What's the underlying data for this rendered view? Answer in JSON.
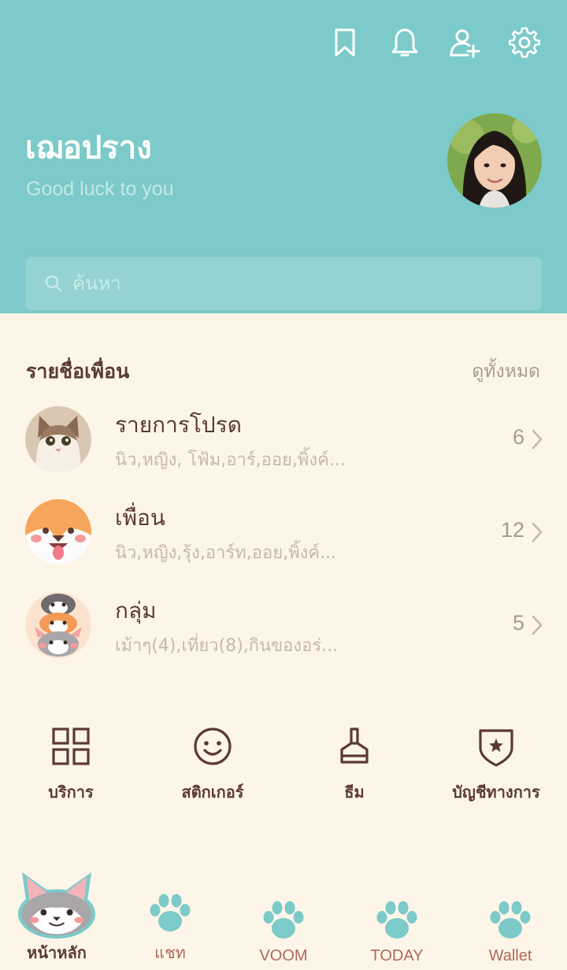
{
  "header": {
    "icons": [
      "bookmark-icon",
      "bell-icon",
      "add-friend-icon",
      "gear-icon"
    ],
    "profile_name": "เฌอปราง",
    "status_message": "Good luck to you",
    "search_placeholder": "ค้นหา"
  },
  "friends_section": {
    "title": "รายชื่อเพื่อน",
    "see_all": "ดูทั้งหมด",
    "rows": [
      {
        "title": "รายการโปรด",
        "subtitle": "นิว,หญิง, โฟ้ม,อาร์,ออย,พิ้งค์...",
        "count": "6"
      },
      {
        "title": "เพื่อน",
        "subtitle": "นิว,หญิง,รุ้ง,อาร์ท,ออย,พิ้งค์...",
        "count": "12"
      },
      {
        "title": "กลุ่ม",
        "subtitle": "เม้าๆ(4),เที่ยว(8),กินของอร่...",
        "count": "5"
      }
    ]
  },
  "services": [
    {
      "label": "บริการ",
      "icon": "grid-icon"
    },
    {
      "label": "สติกเกอร์",
      "icon": "smiley-icon"
    },
    {
      "label": "ธีม",
      "icon": "brush-icon"
    },
    {
      "label": "บัญชีทางการ",
      "icon": "shield-star-icon"
    }
  ],
  "bottom_nav": [
    {
      "label": "หน้าหลัก",
      "icon": "corgi-icon",
      "active": true
    },
    {
      "label": "แชท",
      "icon": "paw-icon"
    },
    {
      "label": "VOOM",
      "icon": "paw-icon"
    },
    {
      "label": "TODAY",
      "icon": "paw-icon"
    },
    {
      "label": "Wallet",
      "icon": "paw-icon"
    }
  ],
  "colors": {
    "header_bg": "#7ccac9",
    "body_bg": "#fdf6e8",
    "text_brown": "#5b3a33",
    "paw_teal": "#7ccac9",
    "nav_label": "#b0685b"
  }
}
